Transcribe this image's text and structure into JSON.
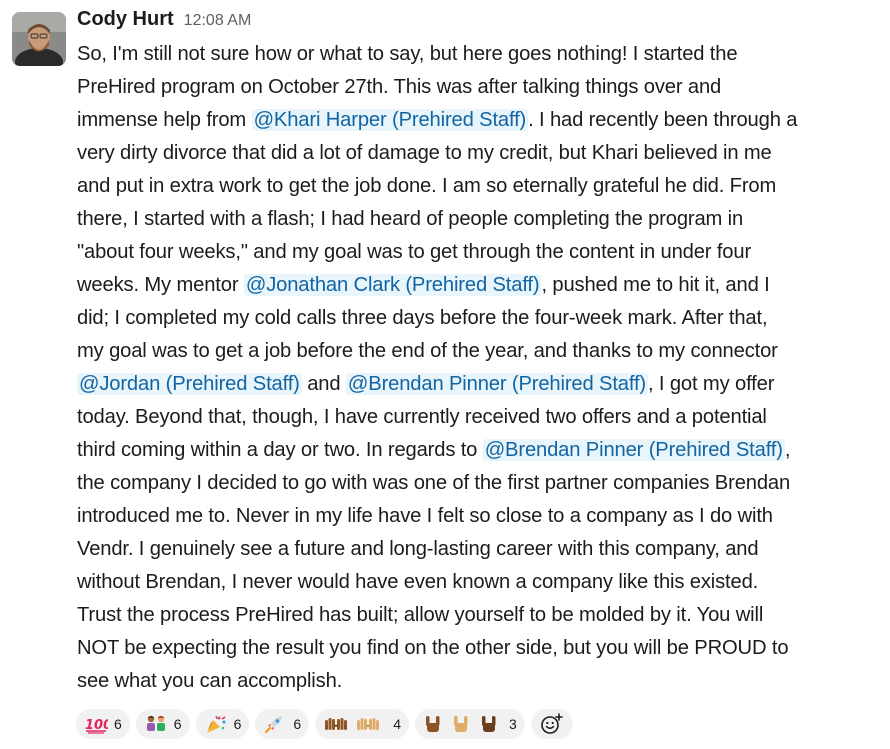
{
  "message": {
    "author": "Cody Hurt",
    "timestamp": "12:08 AM",
    "lines": [
      [
        "So, I'm still not sure how or what to say, but here goes nothing! I started the"
      ],
      [
        "PreHired program on October 27th. This was after talking things over and"
      ],
      [
        "immense help from ",
        {
          "mention": "@Khari Harper (Prehired Staff)"
        },
        ". I had recently been through a"
      ],
      [
        "very dirty divorce that did a lot of damage to my credit, but Khari believed in me"
      ],
      [
        "and put in extra work to get the job done. I am so eternally grateful he did. From"
      ],
      [
        "there, I started with a flash; I had heard of people completing the program in"
      ],
      [
        "\"about four weeks,\" and my goal was to get through the content in under four"
      ],
      [
        "weeks. My mentor ",
        {
          "mention": "@Jonathan Clark (Prehired Staff)"
        },
        ", pushed me to hit it, and I"
      ],
      [
        "did; I completed my cold calls three days before the four-week mark. After that,"
      ],
      [
        "my goal was to get a job before the end of the year, and thanks to my connector"
      ],
      [
        {
          "mention": "@Jordan (Prehired Staff)"
        },
        " and ",
        {
          "mention": "@Brendan Pinner (Prehired Staff)"
        },
        ", I got my offer"
      ],
      [
        "today. Beyond that, though, I have currently received two offers and a potential"
      ],
      [
        "third coming within a day or two. In regards to ",
        {
          "mention": "@Brendan Pinner (Prehired Staff)"
        },
        ","
      ],
      [
        "the company I decided to go with was one of the first partner companies Brendan"
      ],
      [
        "introduced me to. Never in my life have I felt so close to a company as I do with"
      ],
      [
        "Vendr. I genuinely see a future and long-lasting career with this company, and"
      ],
      [
        "without Brendan, I never would have even known a company like this existed."
      ],
      [
        "Trust the process PreHired has built; allow yourself to be molded by it. You will"
      ],
      [
        "NOT be expecting the result you find on the other side, but you will be PROUD to"
      ],
      [
        "see what you can accomplish."
      ]
    ]
  },
  "reactions": [
    {
      "icon": "hundred-points-icon",
      "count": "6"
    },
    {
      "icon": "people-holding-hands-icon",
      "count": "6"
    },
    {
      "icon": "party-popper-icon",
      "count": "6"
    },
    {
      "icon": "rocket-icon",
      "count": "6"
    },
    {
      "icon": "raised-hands-icon",
      "count": "4"
    },
    {
      "icon": "sign-of-horns-icon",
      "count": "3"
    }
  ],
  "colors": {
    "mention_text": "#1264a3",
    "mention_bg": "#e8f5fa",
    "reaction_bg": "#f1f1f1",
    "timestamp": "#616061"
  }
}
